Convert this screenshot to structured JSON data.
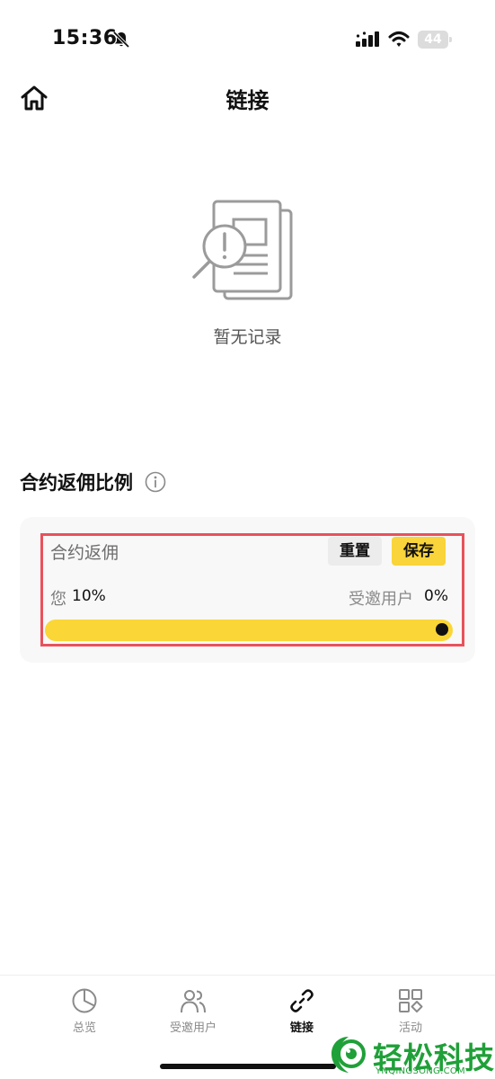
{
  "status_bar": {
    "time": "15:36",
    "battery": "44"
  },
  "header": {
    "title": "链接"
  },
  "empty_state": {
    "text": "暂无记录"
  },
  "section": {
    "title": "合约返佣比例"
  },
  "rebate": {
    "label": "合约返佣",
    "reset_label": "重置",
    "save_label": "保存",
    "you_label": "您",
    "you_value": "10%",
    "invited_label": "受邀用户",
    "invited_value": "0%",
    "slider_fraction": 1.0
  },
  "tabs": [
    {
      "label": "总览",
      "icon": "pie-chart-icon",
      "active": false
    },
    {
      "label": "受邀用户",
      "icon": "users-icon",
      "active": false
    },
    {
      "label": "链接",
      "icon": "link-icon",
      "active": true
    },
    {
      "label": "活动",
      "icon": "apps-icon",
      "active": false
    }
  ],
  "watermark": {
    "text": "轻松科技",
    "sub": "YNQINGSONG.COM"
  },
  "colors": {
    "accent": "#fad636",
    "highlight": "#e8525c",
    "watermark": "#1fa038"
  }
}
